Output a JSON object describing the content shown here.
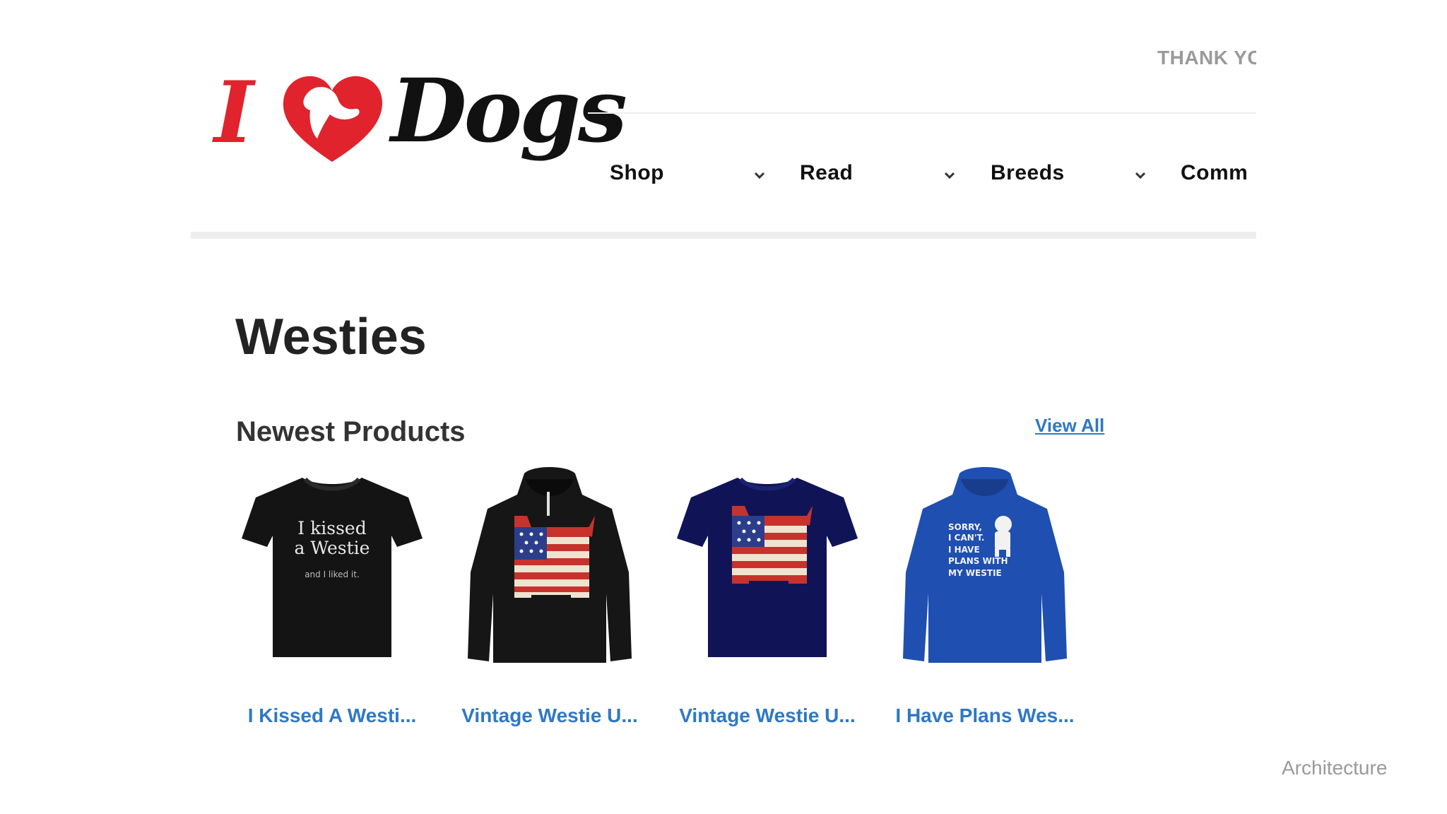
{
  "header": {
    "logo": {
      "text_left": "I",
      "text_right": "Dogs",
      "heart_color": "#e0232c"
    },
    "top_link": "THANK YC"
  },
  "nav": {
    "items": [
      {
        "label": "Shop"
      },
      {
        "label": "Read"
      },
      {
        "label": "Breeds"
      },
      {
        "label": "Comm"
      }
    ]
  },
  "main": {
    "title": "Westies",
    "section": {
      "title": "Newest Products",
      "view_all": "View All",
      "products": [
        {
          "name": "I Kissed A Westi...",
          "type": "t-shirt",
          "color": "#141414",
          "print_lines": [
            "I kissed",
            "a Westie"
          ],
          "print_small": "and I liked it."
        },
        {
          "name": "Vintage Westie U...",
          "type": "hoodie",
          "color": "#161616"
        },
        {
          "name": "Vintage Westie U...",
          "type": "t-shirt",
          "color": "#101457"
        },
        {
          "name": "I Have Plans Wes...",
          "type": "hoodie",
          "color": "#1f4fb0",
          "print_lines": [
            "SORRY,",
            "I CAN'T.",
            "I HAVE",
            "PLANS WITH",
            "MY WESTIE"
          ]
        }
      ]
    }
  },
  "watermark": "Architecture",
  "colors": {
    "link": "#2f78c4",
    "brand_red": "#e0232c",
    "rule": "#eeeeee"
  }
}
